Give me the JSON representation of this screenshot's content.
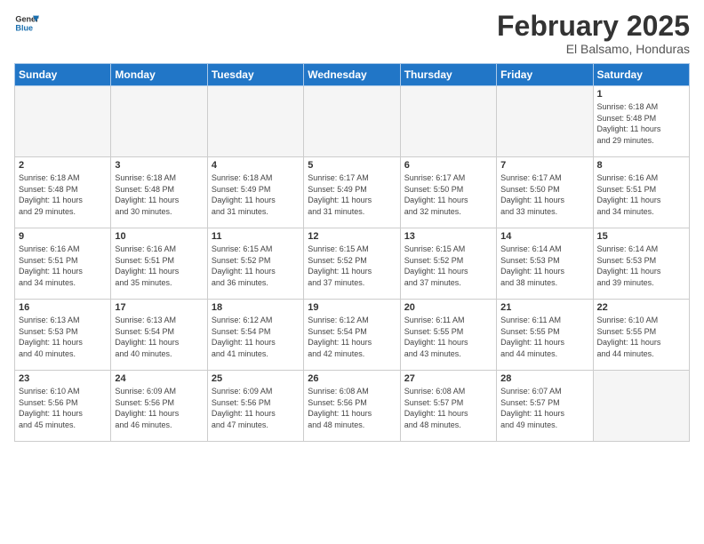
{
  "logo": {
    "line1": "General",
    "line2": "Blue"
  },
  "title": "February 2025",
  "subtitle": "El Balsamo, Honduras",
  "days_of_week": [
    "Sunday",
    "Monday",
    "Tuesday",
    "Wednesday",
    "Thursday",
    "Friday",
    "Saturday"
  ],
  "weeks": [
    [
      {
        "day": "",
        "info": ""
      },
      {
        "day": "",
        "info": ""
      },
      {
        "day": "",
        "info": ""
      },
      {
        "day": "",
        "info": ""
      },
      {
        "day": "",
        "info": ""
      },
      {
        "day": "",
        "info": ""
      },
      {
        "day": "1",
        "info": "Sunrise: 6:18 AM\nSunset: 5:48 PM\nDaylight: 11 hours\nand 29 minutes."
      }
    ],
    [
      {
        "day": "2",
        "info": "Sunrise: 6:18 AM\nSunset: 5:48 PM\nDaylight: 11 hours\nand 29 minutes."
      },
      {
        "day": "3",
        "info": "Sunrise: 6:18 AM\nSunset: 5:48 PM\nDaylight: 11 hours\nand 30 minutes."
      },
      {
        "day": "4",
        "info": "Sunrise: 6:18 AM\nSunset: 5:49 PM\nDaylight: 11 hours\nand 31 minutes."
      },
      {
        "day": "5",
        "info": "Sunrise: 6:17 AM\nSunset: 5:49 PM\nDaylight: 11 hours\nand 31 minutes."
      },
      {
        "day": "6",
        "info": "Sunrise: 6:17 AM\nSunset: 5:50 PM\nDaylight: 11 hours\nand 32 minutes."
      },
      {
        "day": "7",
        "info": "Sunrise: 6:17 AM\nSunset: 5:50 PM\nDaylight: 11 hours\nand 33 minutes."
      },
      {
        "day": "8",
        "info": "Sunrise: 6:16 AM\nSunset: 5:51 PM\nDaylight: 11 hours\nand 34 minutes."
      }
    ],
    [
      {
        "day": "9",
        "info": "Sunrise: 6:16 AM\nSunset: 5:51 PM\nDaylight: 11 hours\nand 34 minutes."
      },
      {
        "day": "10",
        "info": "Sunrise: 6:16 AM\nSunset: 5:51 PM\nDaylight: 11 hours\nand 35 minutes."
      },
      {
        "day": "11",
        "info": "Sunrise: 6:15 AM\nSunset: 5:52 PM\nDaylight: 11 hours\nand 36 minutes."
      },
      {
        "day": "12",
        "info": "Sunrise: 6:15 AM\nSunset: 5:52 PM\nDaylight: 11 hours\nand 37 minutes."
      },
      {
        "day": "13",
        "info": "Sunrise: 6:15 AM\nSunset: 5:52 PM\nDaylight: 11 hours\nand 37 minutes."
      },
      {
        "day": "14",
        "info": "Sunrise: 6:14 AM\nSunset: 5:53 PM\nDaylight: 11 hours\nand 38 minutes."
      },
      {
        "day": "15",
        "info": "Sunrise: 6:14 AM\nSunset: 5:53 PM\nDaylight: 11 hours\nand 39 minutes."
      }
    ],
    [
      {
        "day": "16",
        "info": "Sunrise: 6:13 AM\nSunset: 5:53 PM\nDaylight: 11 hours\nand 40 minutes."
      },
      {
        "day": "17",
        "info": "Sunrise: 6:13 AM\nSunset: 5:54 PM\nDaylight: 11 hours\nand 40 minutes."
      },
      {
        "day": "18",
        "info": "Sunrise: 6:12 AM\nSunset: 5:54 PM\nDaylight: 11 hours\nand 41 minutes."
      },
      {
        "day": "19",
        "info": "Sunrise: 6:12 AM\nSunset: 5:54 PM\nDaylight: 11 hours\nand 42 minutes."
      },
      {
        "day": "20",
        "info": "Sunrise: 6:11 AM\nSunset: 5:55 PM\nDaylight: 11 hours\nand 43 minutes."
      },
      {
        "day": "21",
        "info": "Sunrise: 6:11 AM\nSunset: 5:55 PM\nDaylight: 11 hours\nand 44 minutes."
      },
      {
        "day": "22",
        "info": "Sunrise: 6:10 AM\nSunset: 5:55 PM\nDaylight: 11 hours\nand 44 minutes."
      }
    ],
    [
      {
        "day": "23",
        "info": "Sunrise: 6:10 AM\nSunset: 5:56 PM\nDaylight: 11 hours\nand 45 minutes."
      },
      {
        "day": "24",
        "info": "Sunrise: 6:09 AM\nSunset: 5:56 PM\nDaylight: 11 hours\nand 46 minutes."
      },
      {
        "day": "25",
        "info": "Sunrise: 6:09 AM\nSunset: 5:56 PM\nDaylight: 11 hours\nand 47 minutes."
      },
      {
        "day": "26",
        "info": "Sunrise: 6:08 AM\nSunset: 5:56 PM\nDaylight: 11 hours\nand 48 minutes."
      },
      {
        "day": "27",
        "info": "Sunrise: 6:08 AM\nSunset: 5:57 PM\nDaylight: 11 hours\nand 48 minutes."
      },
      {
        "day": "28",
        "info": "Sunrise: 6:07 AM\nSunset: 5:57 PM\nDaylight: 11 hours\nand 49 minutes."
      },
      {
        "day": "",
        "info": ""
      }
    ]
  ]
}
